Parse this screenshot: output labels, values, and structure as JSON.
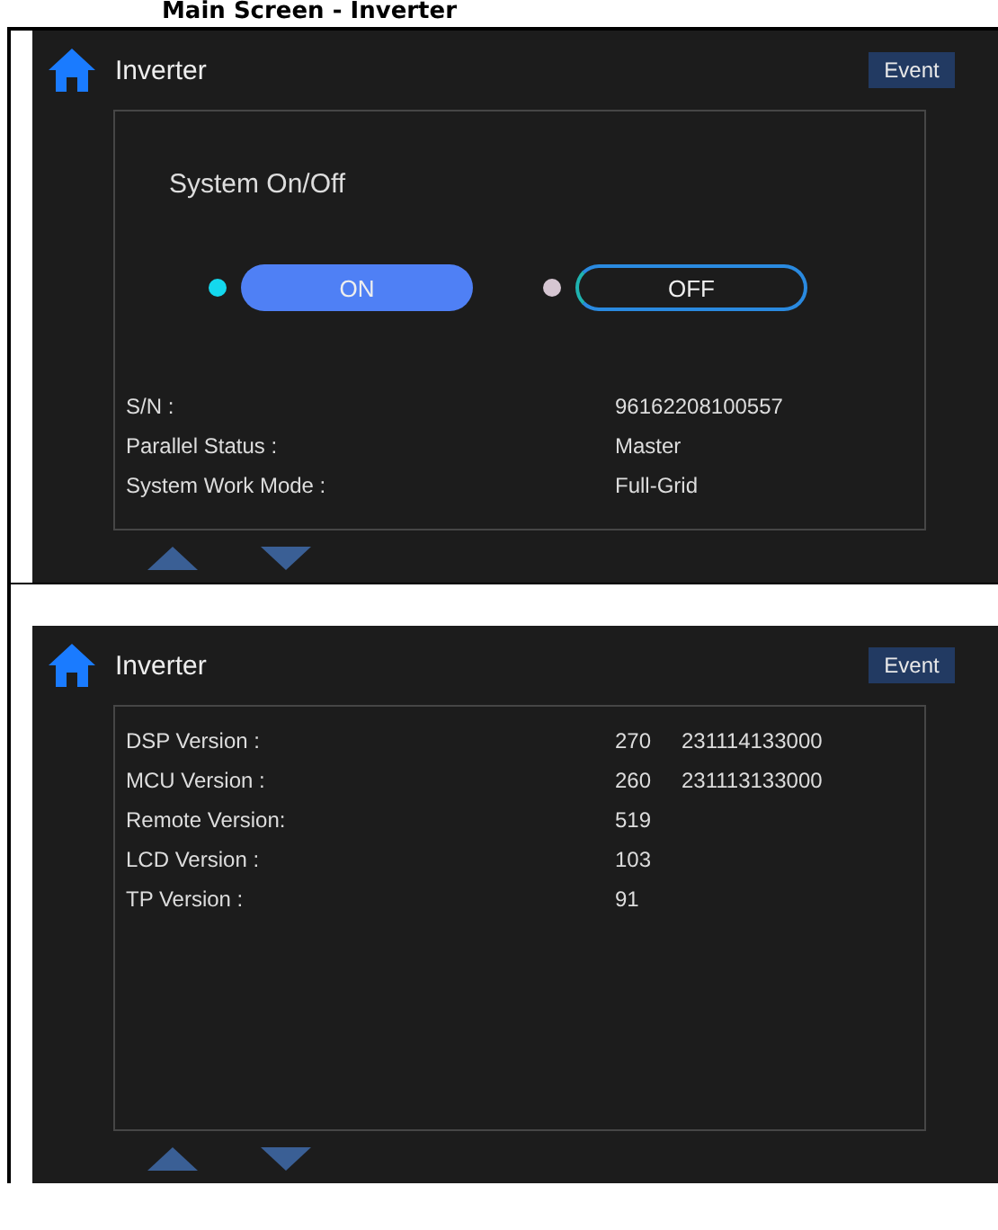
{
  "heading": "Main Screen - Inverter",
  "screens": [
    {
      "title": "Inverter",
      "event_button": "Event",
      "power": {
        "title": "System On/Off",
        "options": [
          {
            "label": "ON",
            "selected": true
          },
          {
            "label": "OFF",
            "selected": false
          }
        ]
      },
      "info_rows": [
        {
          "label": "S/N :",
          "values": [
            "96162208100557"
          ]
        },
        {
          "label": "Parallel Status :",
          "values": [
            "Master"
          ]
        },
        {
          "label": "System Work Mode :",
          "values": [
            "Full-Grid"
          ]
        }
      ]
    },
    {
      "title": "Inverter",
      "event_button": "Event",
      "info_rows": [
        {
          "label": "DSP Version :",
          "values": [
            "270",
            "231114133000"
          ]
        },
        {
          "label": "MCU Version :",
          "values": [
            "260",
            "231113133000"
          ]
        },
        {
          "label": "Remote Version:",
          "values": [
            "519"
          ]
        },
        {
          "label": "LCD Version :",
          "values": [
            "103"
          ]
        },
        {
          "label": "TP Version :",
          "values": [
            "91"
          ]
        }
      ]
    }
  ]
}
